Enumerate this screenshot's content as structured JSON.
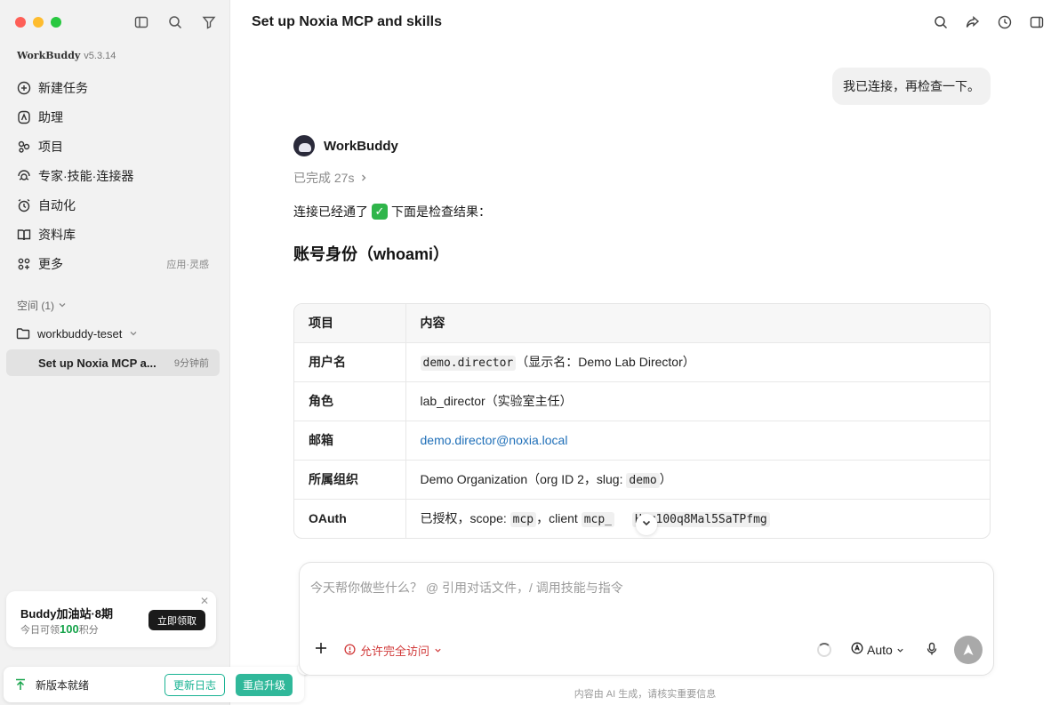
{
  "sidebar": {
    "app_name": "WorkBuddy",
    "version": "v5.3.14",
    "nav": [
      {
        "label": "新建任务",
        "icon": "plus-circle-icon"
      },
      {
        "label": "助理",
        "icon": "assistant-icon"
      },
      {
        "label": "项目",
        "icon": "project-icon"
      },
      {
        "label": "专家·技能·连接器",
        "icon": "experts-icon"
      },
      {
        "label": "自动化",
        "icon": "alarm-clock-icon"
      },
      {
        "label": "资料库",
        "icon": "book-icon"
      },
      {
        "label": "更多",
        "icon": "more-grid-icon",
        "sub": "应用·灵感"
      }
    ],
    "space_label": "空间 (1)",
    "workspace": "workbuddy-teset",
    "session": {
      "title": "Set up Noxia MCP a...",
      "time": "9分钟前"
    },
    "promo": {
      "title": "Buddy加油站·8期",
      "pre": "今日可领",
      "points": "100",
      "post": "积分",
      "button": "立即领取"
    },
    "update": {
      "text": "新版本就绪",
      "log_button": "更新日志",
      "restart_button": "重启升级"
    }
  },
  "main": {
    "title": "Set up Noxia MCP and skills",
    "user_message": "我已连接，再检查一下。",
    "assistant_name": "WorkBuddy",
    "status": "已完成 27s",
    "intro_pre": "连接已经通了",
    "intro_post": "下面是检查结果：",
    "section_title": "账号身份（whoami）",
    "table": {
      "headers": [
        "项目",
        "内容"
      ],
      "rows": [
        {
          "key": "用户名",
          "code1": "demo.director",
          "text": "（显示名：Demo Lab Director）"
        },
        {
          "key": "角色",
          "text": "lab_director（实验室主任）"
        },
        {
          "key": "邮箱",
          "link": "demo.director@noxia.local"
        },
        {
          "key": "所属组织",
          "text": "Demo Organization（org ID 2，slug: ",
          "code1": "demo",
          "text2": "）"
        },
        {
          "key": "OAuth",
          "text": "已授权，scope: ",
          "code1": "mcp",
          "text2": "，client ",
          "code2": "mcp_",
          "code3": "Hsr100q8Mal5SaTPfmg"
        }
      ]
    },
    "composer": {
      "placeholder": "今天帮你做些什么？ @ 引用对话文件，/ 调用技能与指令",
      "access": "允许完全访问",
      "model": "Auto"
    },
    "disclaimer": "内容由 AI 生成，请核实重要信息"
  }
}
